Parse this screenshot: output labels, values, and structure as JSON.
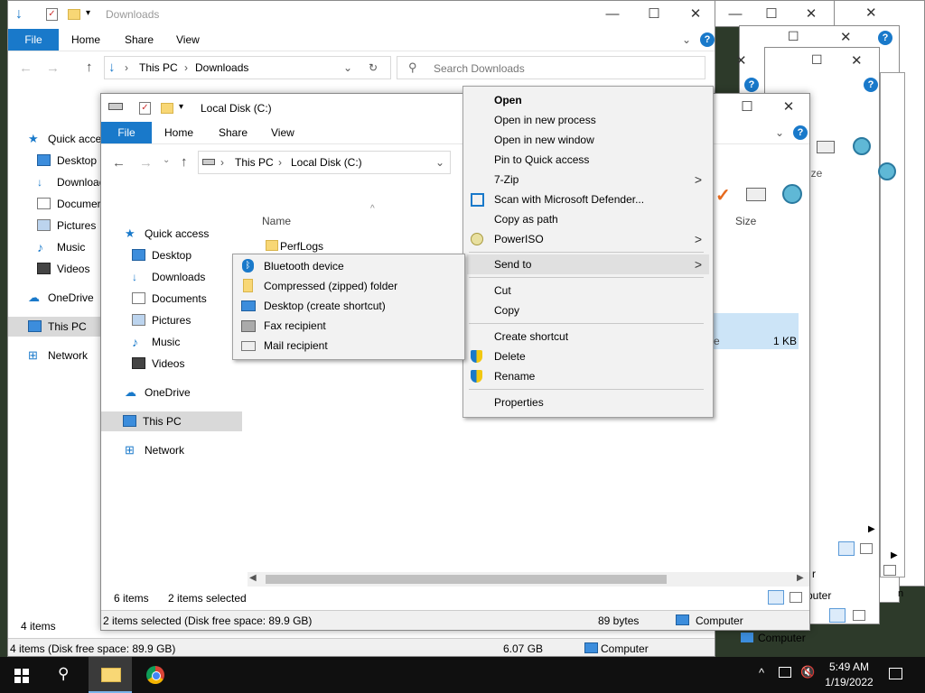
{
  "desktop_bg": "#2d3a2a",
  "accent": "#1979ca",
  "downloads_window": {
    "title": "Downloads",
    "ribbon": [
      "File",
      "Home",
      "Share",
      "View"
    ],
    "address": [
      "This PC",
      "Downloads"
    ],
    "search_placeholder": "Search Downloads",
    "nav": [
      "Quick acce",
      "Desktop",
      "Download",
      "Documer",
      "Pictures",
      "Music",
      "Videos",
      "OneDrive",
      "This PC",
      "Network"
    ],
    "status_left": "4 items",
    "status_bar": "4 items (Disk free space: 89.9 GB)",
    "status_size": "6.07 GB",
    "status_computer": "Computer"
  },
  "back_windows": {
    "computer_label": "Computer",
    "size_header": "ize",
    "fragment_r": "r",
    "fragment_n": "n",
    "fragment_uter": "puter",
    "fragment_e": "e",
    "size_1kb": "1 KB"
  },
  "local_window": {
    "title": "Local Disk (C:)",
    "ribbon": [
      "File",
      "Home",
      "Share",
      "View"
    ],
    "address": [
      "This PC",
      "Local Disk (C:)"
    ],
    "nav": [
      "Quick access",
      "Desktop",
      "Downloads",
      "Documents",
      "Pictures",
      "Music",
      "Videos",
      "OneDrive",
      "This PC",
      "Network"
    ],
    "col_name": "Name",
    "col_size": "Size",
    "first_item": "PerfLogs",
    "item_count": "6 items",
    "selected_count": "2 items selected",
    "status_bar": "2 items selected (Disk free space: 89.9 GB)",
    "status_bytes": "89 bytes",
    "status_computer": "Computer"
  },
  "context_menu": {
    "items": [
      {
        "label": "Open",
        "bold": true
      },
      {
        "label": "Open in new process"
      },
      {
        "label": "Open in new window"
      },
      {
        "label": "Pin to Quick access"
      },
      {
        "label": "7-Zip"
      },
      {
        "label": "Scan with Microsoft Defender..."
      },
      {
        "label": "Copy as path"
      },
      {
        "label": "PowerISO"
      },
      {
        "label": "Send to"
      },
      {
        "label": "Cut"
      },
      {
        "label": "Copy"
      },
      {
        "label": "Create shortcut"
      },
      {
        "label": "Delete"
      },
      {
        "label": "Rename"
      },
      {
        "label": "Properties"
      }
    ],
    "submenu_arrow": ">"
  },
  "send_to_menu": {
    "items": [
      "Bluetooth device",
      "Compressed (zipped) folder",
      "Desktop (create shortcut)",
      "Fax recipient",
      "Mail recipient"
    ]
  },
  "taskbar": {
    "time": "5:49 AM",
    "date": "1/19/2022"
  }
}
